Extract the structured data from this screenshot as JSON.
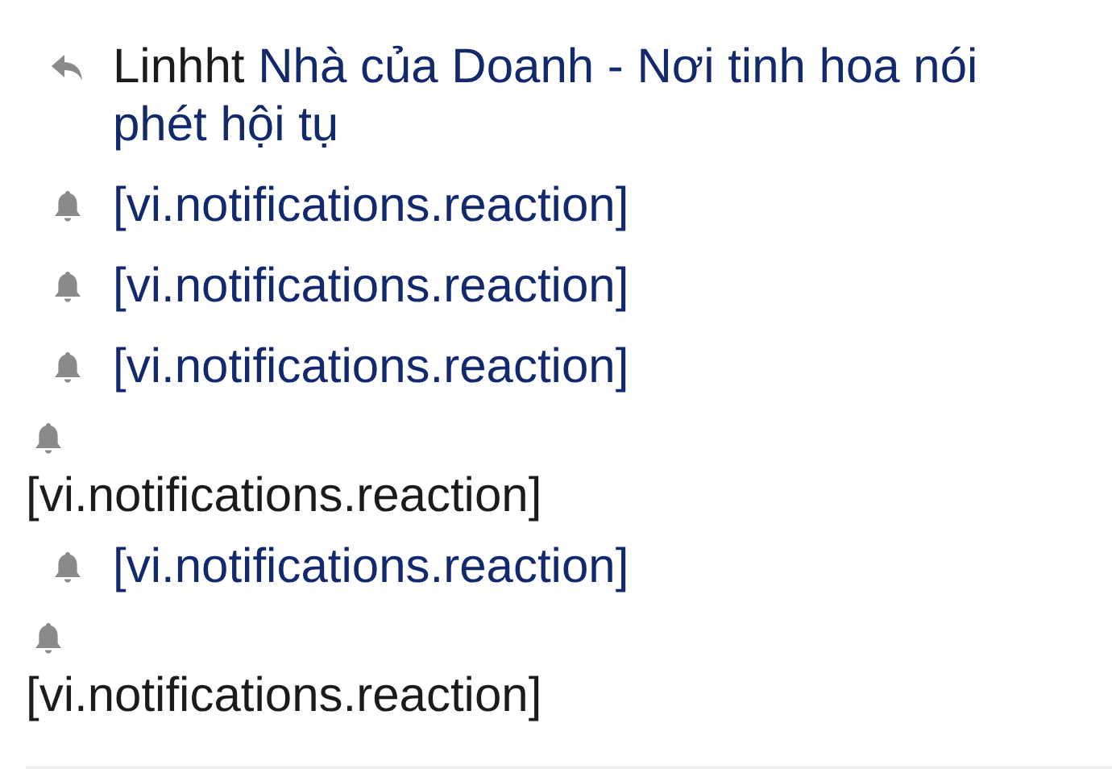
{
  "notifications": [
    {
      "kind": "reply",
      "stacked": false,
      "user": "Linhht",
      "text": "Nhà của Doanh - Nơi tinh hoa nói phét hội tụ"
    },
    {
      "kind": "reaction",
      "stacked": false,
      "text": "[vi.notifications.reaction]"
    },
    {
      "kind": "reaction",
      "stacked": false,
      "text": "[vi.notifications.reaction]"
    },
    {
      "kind": "reaction",
      "stacked": false,
      "text": "[vi.notifications.reaction]"
    },
    {
      "kind": "reaction",
      "stacked": true,
      "text": "[vi.notifications.reaction]"
    },
    {
      "kind": "reaction",
      "stacked": false,
      "text": "[vi.notifications.reaction]"
    },
    {
      "kind": "reaction",
      "stacked": true,
      "text": "[vi.notifications.reaction]"
    }
  ]
}
